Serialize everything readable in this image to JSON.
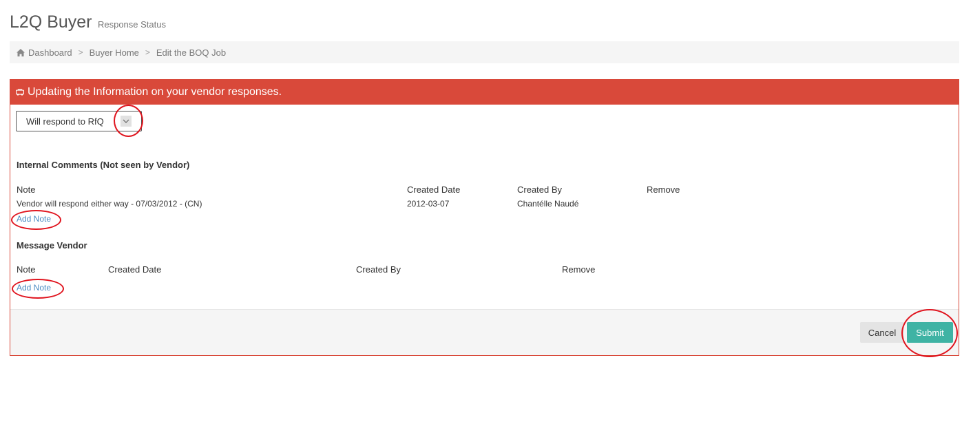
{
  "header": {
    "title": "L2Q Buyer",
    "subtitle": "Response Status"
  },
  "breadcrumb": {
    "items": [
      "Dashboard",
      "Buyer Home",
      "Edit the BOQ Job"
    ],
    "separator": ">"
  },
  "panel": {
    "heading": "Updating the Information on your vendor responses.",
    "status_select": {
      "value": "Will respond to RfQ"
    },
    "internal": {
      "title": "Internal Comments (Not seen by Vendor)",
      "columns": [
        "Note",
        "Created Date",
        "Created By",
        "Remove"
      ],
      "rows": [
        {
          "note": "Vendor will respond either way - 07/03/2012 - (CN)",
          "date": "2012-03-07",
          "by": "Chantélle Naudé"
        }
      ],
      "add_note": "Add Note"
    },
    "vendor": {
      "title": "Message Vendor",
      "columns": [
        "Note",
        "Created Date",
        "Created By",
        "Remove"
      ],
      "add_note": "Add Note"
    },
    "footer": {
      "cancel": "Cancel",
      "submit": "Submit"
    }
  },
  "colors": {
    "danger": "#d9493a",
    "submit": "#3fb3a4",
    "link": "#4a8bc2",
    "annotation": "#e0141e"
  }
}
